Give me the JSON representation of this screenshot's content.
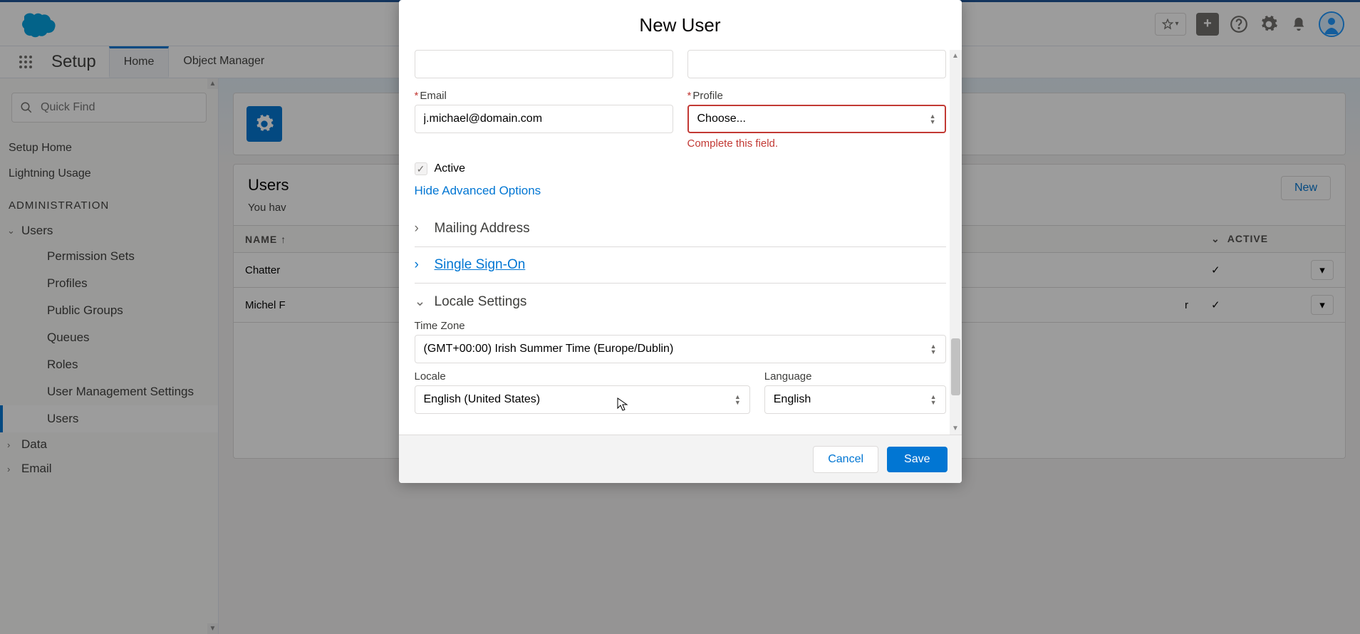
{
  "header": {
    "setup_label": "Setup",
    "tabs": {
      "home": "Home",
      "object_manager": "Object Manager"
    }
  },
  "sidebar": {
    "quickfind_placeholder": "Quick Find",
    "setup_home": "Setup Home",
    "lightning_usage": "Lightning Usage",
    "admin_section": "ADMINISTRATION",
    "users_tree": "Users",
    "users_children": {
      "permission_sets": "Permission Sets",
      "profiles": "Profiles",
      "public_groups": "Public Groups",
      "queues": "Queues",
      "roles": "Roles",
      "user_mgmt": "User Management Settings",
      "users": "Users"
    },
    "data": "Data",
    "email": "Email"
  },
  "page": {
    "users_title": "Users",
    "you_have": "You hav",
    "new_btn": "New",
    "col_name": "NAME",
    "col_active": "ACTIVE",
    "row1": "Chatter",
    "row2": "Michel F",
    "row2_suffix": "r"
  },
  "modal": {
    "title": "New User",
    "email_label": "Email",
    "email_value": "j.michael@domain.com",
    "profile_label": "Profile",
    "profile_placeholder": "Choose...",
    "profile_error": "Complete this field.",
    "active_label": "Active",
    "hide_advanced": "Hide Advanced Options",
    "mailing_address": "Mailing Address",
    "sso": "Single Sign-On",
    "locale_settings": "Locale Settings",
    "timezone_label": "Time Zone",
    "timezone_value": "(GMT+00:00) Irish Summer Time (Europe/Dublin)",
    "locale_label": "Locale",
    "locale_value": "English (United States)",
    "language_label": "Language",
    "language_value": "English",
    "cancel": "Cancel",
    "save": "Save"
  }
}
